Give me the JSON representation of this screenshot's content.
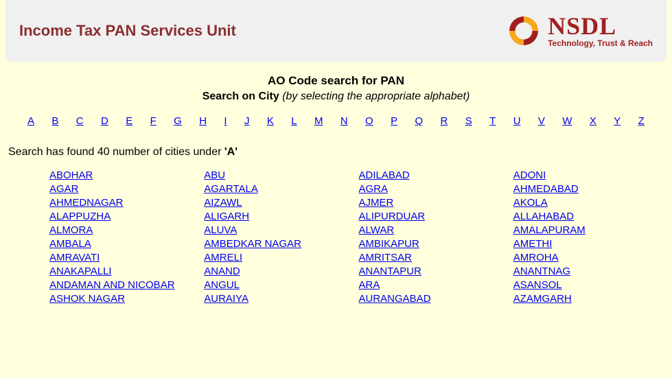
{
  "header": {
    "title": "Income Tax PAN Services Unit",
    "logo": {
      "main": "NSDL",
      "tagline": "Technology, Trust & Reach"
    }
  },
  "main_heading": "AO Code search for PAN",
  "sub_heading": {
    "bold": "Search on City",
    "italic": "(by selecting the appropriate alphabet)"
  },
  "alphabet": [
    "A",
    "B",
    "C",
    "D",
    "E",
    "F",
    "G",
    "H",
    "I",
    "J",
    "K",
    "L",
    "M",
    "N",
    "O",
    "P",
    "Q",
    "R",
    "S",
    "T",
    "U",
    "V",
    "W",
    "X",
    "Y",
    "Z"
  ],
  "result": {
    "prefix": "Search has found 40 number of cities under ",
    "letter": "'A'"
  },
  "cities_by_row": [
    [
      "ABOHAR",
      "ABU",
      "ADILABAD",
      "ADONI"
    ],
    [
      "AGAR",
      "AGARTALA",
      "AGRA",
      "AHMEDABAD"
    ],
    [
      "AHMEDNAGAR",
      "AIZAWL",
      "AJMER",
      "AKOLA"
    ],
    [
      "ALAPPUZHA",
      "ALIGARH",
      "ALIPURDUAR",
      "ALLAHABAD"
    ],
    [
      "ALMORA",
      "ALUVA",
      "ALWAR",
      "AMALAPURAM"
    ],
    [
      "AMBALA",
      "AMBEDKAR NAGAR",
      "AMBIKAPUR",
      "AMETHI"
    ],
    [
      "AMRAVATI",
      "AMRELI",
      "AMRITSAR",
      "AMROHA"
    ],
    [
      "ANAKAPALLI",
      "ANAND",
      "ANANTAPUR",
      "ANANTNAG"
    ],
    [
      "ANDAMAN AND NICOBAR",
      "ANGUL",
      "ARA",
      "ASANSOL"
    ],
    [
      "ASHOK NAGAR",
      "AURAIYA",
      "AURANGABAD",
      "AZAMGARH"
    ]
  ]
}
